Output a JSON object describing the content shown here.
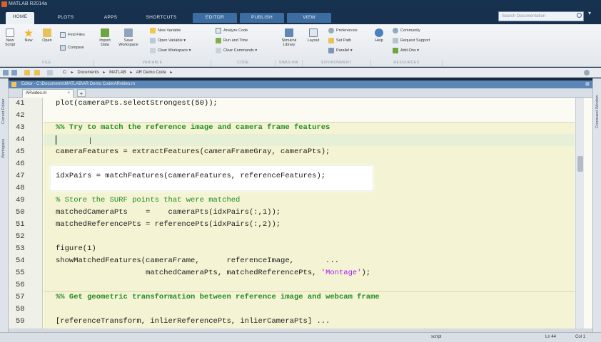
{
  "window": {
    "title": "MATLAB R2014a"
  },
  "tabs": [
    {
      "label": "HOME"
    },
    {
      "label": "PLOTS"
    },
    {
      "label": "APPS"
    },
    {
      "label": "SHORTCUTS"
    },
    {
      "label": "EDITOR"
    },
    {
      "label": "PUBLISH"
    },
    {
      "label": "VIEW"
    }
  ],
  "search": {
    "placeholder": "Search Documentation"
  },
  "ribbon": {
    "new_script": "New\nScript",
    "new": "New",
    "open": "Open",
    "find_files": "Find Files",
    "compare": "Compare",
    "import_data": "Import\nData",
    "save_workspace": "Save\nWorkspace",
    "new_variable": "New Variable",
    "open_variable": "Open Variable ▾",
    "clear_workspace": "Clear Workspace ▾",
    "analyze_code": "Analyze Code",
    "run_and_time": "Run and Time",
    "clear_commands": "Clear Commands ▾",
    "simulink_library": "Simulink\nLibrary",
    "layout": "Layout",
    "preferences": "Preferences",
    "set_path": "Set Path",
    "parallel": "Parallel ▾",
    "help": "Help",
    "community": "Community",
    "request_support": "Request Support",
    "add_ons": "Add-Ons ▾",
    "groups": {
      "file": "FILE",
      "variable": "VARIABLE",
      "code": "CODE",
      "simulink": "SIMULINK",
      "environment": "ENVIRONMENT",
      "resources": "RESOURCES"
    }
  },
  "address": {
    "crumbs": [
      "C:",
      "▸",
      "Documents",
      "▸",
      "MATLAB",
      "▸",
      "AR Demo Code",
      "▸"
    ]
  },
  "side": {
    "left_top": "Current Folder",
    "left_bottom": "Workspace",
    "right": "Command Window"
  },
  "editor": {
    "title": "Editor - C:\\Documents\\MATLAB\\AR Demo Code\\ARvideo.m",
    "file_tab": "ARvideo.m"
  },
  "code": {
    "l41": {
      "num": "41",
      "text": "plot(cameraPts.selectStrongest(50));"
    },
    "l42": {
      "num": "42",
      "text": ""
    },
    "l43": {
      "num": "43",
      "text": "%% Try to match the reference image and camera frame features"
    },
    "l44": {
      "num": "44",
      "text": ""
    },
    "l45": {
      "num": "45",
      "text": "cameraFeatures = extractFeatures(cameraFrameGray, cameraPts);"
    },
    "l46": {
      "num": "46",
      "text": ""
    },
    "l47": {
      "num": "47",
      "text": "idxPairs = matchFeatures(cameraFeatures, referenceFeatures);"
    },
    "l48": {
      "num": "48",
      "text": ""
    },
    "l49": {
      "num": "49",
      "text": "% Store the SURF points that were matched"
    },
    "l50": {
      "num": "50",
      "text": "matchedCameraPts    =    cameraPts(idxPairs(:,1));"
    },
    "l51": {
      "num": "51",
      "text": "matchedReferencePts = referencePts(idxPairs(:,2));"
    },
    "l52": {
      "num": "52",
      "text": ""
    },
    "l53": {
      "num": "53",
      "text": "figure(1)"
    },
    "l54": {
      "num": "54",
      "text": "showMatchedFeatures(cameraFrame,      referenceImage,       ..."
    },
    "l55": {
      "num": "55",
      "pre": "                    matchedCameraPts, matchedReferencePts, ",
      "str": "'Montage'",
      "post": ");"
    },
    "l56": {
      "num": "56",
      "text": ""
    },
    "l57": {
      "num": "57",
      "text": "%% Get geometric transformation between reference image and webcam frame"
    },
    "l58": {
      "num": "58",
      "text": ""
    },
    "l59": {
      "num": "59",
      "text": "[referenceTransform, inlierReferencePts, inlierCameraPts] ..."
    }
  },
  "status": {
    "mode": "script",
    "ln": "Ln  44",
    "col": "Col  1"
  },
  "colors": {
    "accent": "#17324e",
    "editor_tab": "#3d6da0",
    "cell_bg": "#f4f4d4",
    "comment": "#228b22",
    "string": "#a020f0"
  }
}
